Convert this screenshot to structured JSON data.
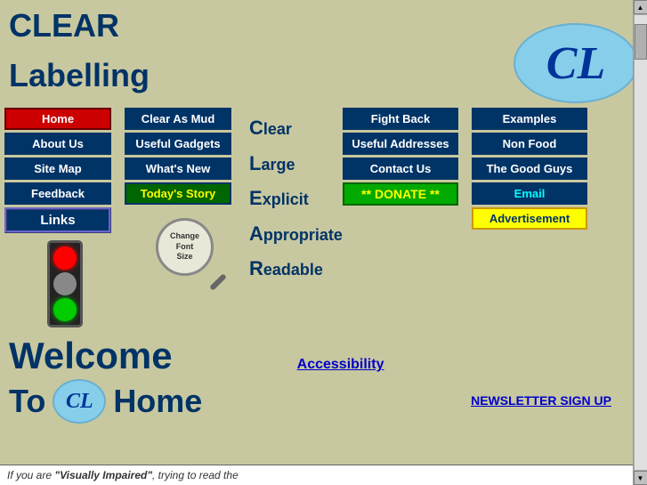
{
  "header": {
    "clear": "CLEAR",
    "labelling": "Labelling",
    "logo_letters": "CL"
  },
  "left_nav": {
    "home": "Home",
    "about_us": "About Us",
    "site_map": "Site Map",
    "feedback": "Feedback",
    "links": "Links"
  },
  "second_col_nav": {
    "clear_as_mud": "Clear As Mud",
    "useful_gadgets": "Useful Gadgets",
    "whats_new": "What's New",
    "todays_story": "Today's Story"
  },
  "acronym": {
    "c_letter": "C",
    "c_word": "lear",
    "l_letter": "L",
    "l_word": "arge",
    "e_letter": "E",
    "e_word": "xplicit",
    "a_letter": "A",
    "a_word": "ppropriate",
    "r_letter": "R",
    "r_word": "eadable"
  },
  "center_btns": {
    "fight_back": "Fight Back",
    "useful_addresses": "Useful Addresses",
    "contact_us": "Contact Us",
    "donate": "** DONATE **"
  },
  "right_btns": {
    "examples": "Examples",
    "non_food": "Non Food",
    "good_guys": "The Good Guys",
    "email": "Email",
    "advertisement": "Advertisement"
  },
  "font_changer": {
    "line1": "Change",
    "line2": "Font",
    "line3": "Size"
  },
  "welcome": {
    "welcome": "Welcome",
    "to": "To",
    "home": "Home",
    "logo": "CL"
  },
  "links": {
    "accessibility": "Accessibility",
    "newsletter": "NEWSLETTER SIGN UP"
  },
  "bottom": {
    "text": "If you are “Visually Impaired”, trying to read the"
  }
}
